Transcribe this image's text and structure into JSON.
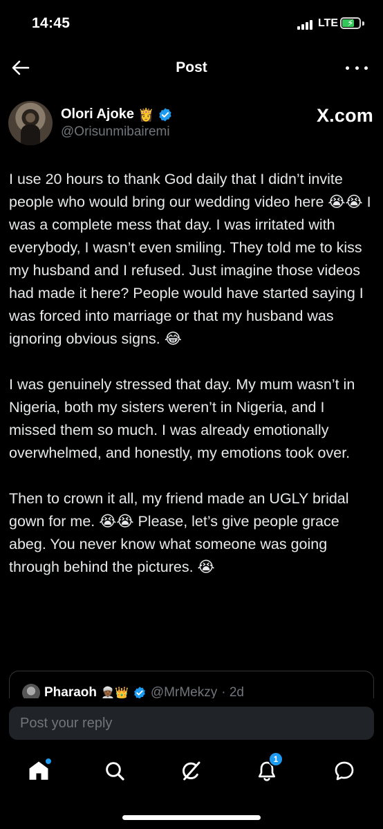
{
  "status_bar": {
    "time": "14:45",
    "network": "LTE",
    "battery_level": 0.7,
    "battery_charging": true
  },
  "header": {
    "title": "Post",
    "back_icon": "arrow-left-icon",
    "more_icon": "more-horizontal-icon"
  },
  "author": {
    "name": "Olori Ajoke",
    "name_emoji": "👸",
    "handle": "@Orisunmibairemi",
    "verified": true,
    "source_watermark": "X.com"
  },
  "post": {
    "paragraphs": [
      "I use 20 hours to thank God daily that I didn’t invite people who would bring our wedding video here 😭😭 I was a complete mess that day. I was irritated with everybody, I wasn’t even smiling. They told me to kiss my husband and I refused. Just imagine those videos had made it here? People would have started saying I was forced into marriage or that my husband was ignoring obvious signs. 😂",
      "I was genuinely stressed that day. My mum wasn’t in Nigeria, both my sisters weren’t in Nigeria, and I missed them so much. I was already emotionally overwhelmed, and honestly, my emotions took over.",
      "Then to crown it all, my friend made an UGLY bridal gown for me. 😭😭 Please, let’s give people grace abeg. You never know what someone was going through behind the pictures. 😭"
    ]
  },
  "quoted_post": {
    "name": "Pharaoh",
    "emojis": "👳🏾👑",
    "verified": true,
    "handle": "@MrMekzy",
    "time": "· 2d"
  },
  "reply": {
    "placeholder": "Post your reply"
  },
  "bottom_nav": {
    "items": [
      "home-icon",
      "search-icon",
      "grok-icon",
      "notifications-icon",
      "messages-icon"
    ],
    "notification_count": "1",
    "accent_color": "#1d9bf0"
  }
}
